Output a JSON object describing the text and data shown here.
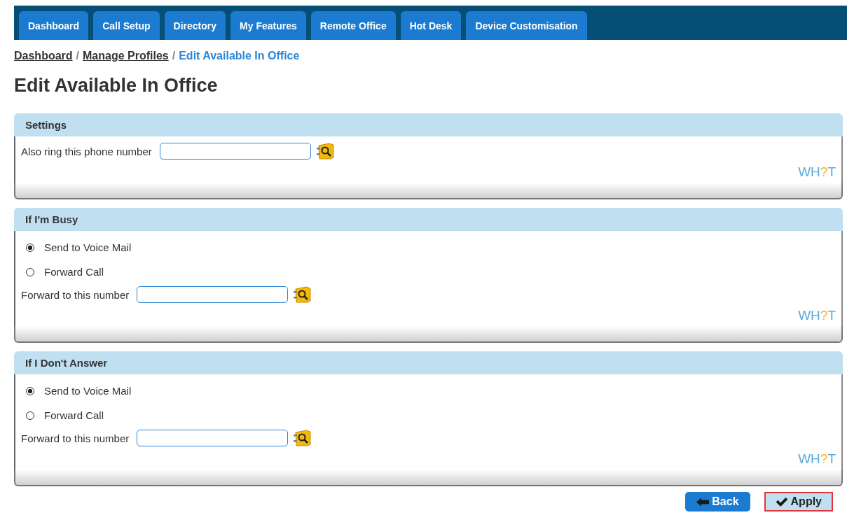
{
  "tabs": [
    {
      "label": "Dashboard",
      "selected": false
    },
    {
      "label": "Call Setup",
      "selected": false
    },
    {
      "label": "Directory",
      "selected": false
    },
    {
      "label": "My Features",
      "selected": false
    },
    {
      "label": "Remote Office",
      "selected": false
    },
    {
      "label": "Hot Desk",
      "selected": false
    },
    {
      "label": "Device Customisation",
      "selected": false
    }
  ],
  "breadcrumb_separator": "/",
  "breadcrumb": [
    {
      "label": "Dashboard",
      "kind": "link"
    },
    {
      "label": "Manage Profiles",
      "kind": "link"
    },
    {
      "label": "Edit Available In Office",
      "kind": "current"
    }
  ],
  "title": "Edit Available In Office",
  "sections": [
    {
      "title": "Settings",
      "rows": [
        {
          "kind": "field",
          "label": "Also ring this phone number"
        }
      ],
      "logo": {
        "before": "WH",
        "mark": "?",
        "after": "T"
      }
    },
    {
      "title": "If I'm Busy",
      "rows": [
        {
          "kind": "radio",
          "label": "Send to Voice Mail",
          "selected": true
        },
        {
          "kind": "radio",
          "label": "Forward Call",
          "selected": false
        },
        {
          "kind": "field",
          "label": "Forward to this number"
        }
      ],
      "logo": {
        "before": "WH",
        "mark": "?",
        "after": "T"
      }
    },
    {
      "title": "If I Don't Answer",
      "rows": [
        {
          "kind": "radio",
          "label": "Send to Voice Mail",
          "selected": true
        },
        {
          "kind": "radio",
          "label": "Forward Call",
          "selected": false
        },
        {
          "kind": "field",
          "label": "Forward to this number"
        }
      ],
      "logo": {
        "before": "WH",
        "mark": "?",
        "after": "T"
      }
    }
  ],
  "buttons": [
    {
      "kind": "back",
      "label": "Back",
      "highlighted": false
    },
    {
      "kind": "apply",
      "label": "Apply",
      "highlighted": true
    }
  ]
}
